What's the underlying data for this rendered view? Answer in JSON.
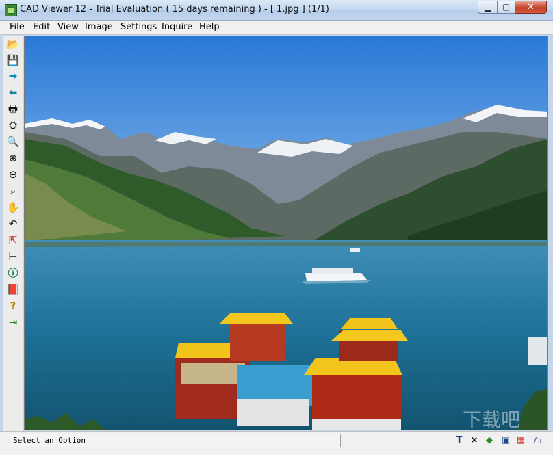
{
  "window": {
    "title": "CAD Viewer 12 - Trial Evaluation ( 15 days remaining )  -  [ 1.jpg ] (1/1)",
    "controls": {
      "minimize": "▁",
      "maximize": "▢",
      "close": "✕"
    }
  },
  "menu": [
    "File",
    "Edit",
    "View",
    "Image",
    "Settings",
    "Inquire",
    "Help"
  ],
  "toolbar": {
    "tools": [
      {
        "name": "open-icon",
        "glyph": "📂"
      },
      {
        "name": "save-icon",
        "glyph": "💾"
      },
      {
        "name": "next-arrow-icon",
        "glyph": "➡"
      },
      {
        "name": "prev-arrow-icon",
        "glyph": "⬅"
      },
      {
        "name": "print-icon",
        "glyph": "🖶"
      },
      {
        "name": "binoculars-icon",
        "glyph": "⛭"
      },
      {
        "name": "zoom-icon",
        "glyph": "🔍"
      },
      {
        "name": "zoom-in-icon",
        "glyph": "⊕"
      },
      {
        "name": "zoom-out-icon",
        "glyph": "⊖"
      },
      {
        "name": "zoom-window-icon",
        "glyph": "⌕"
      },
      {
        "name": "pan-hand-icon",
        "glyph": "✋"
      },
      {
        "name": "undo-icon",
        "glyph": "↶"
      },
      {
        "name": "axes-icon",
        "glyph": "⇱"
      },
      {
        "name": "measure-icon",
        "glyph": "⊢"
      },
      {
        "name": "info-icon",
        "glyph": "ⓘ"
      },
      {
        "name": "book-icon",
        "glyph": "📕"
      },
      {
        "name": "help-icon",
        "glyph": "?"
      },
      {
        "name": "exit-icon",
        "glyph": "⇥"
      }
    ]
  },
  "status": {
    "message": "Select an Option",
    "tools": [
      {
        "name": "text-tool-icon",
        "glyph": "T"
      },
      {
        "name": "close-tool-icon",
        "glyph": "×"
      },
      {
        "name": "shield-icon",
        "glyph": "◆"
      },
      {
        "name": "layout-icon",
        "glyph": "▣"
      },
      {
        "name": "color-icon",
        "glyph": "▦"
      },
      {
        "name": "printer-icon",
        "glyph": "⎙"
      }
    ]
  },
  "image": {
    "file": "1.jpg"
  },
  "watermark": {
    "text": "下载吧"
  }
}
